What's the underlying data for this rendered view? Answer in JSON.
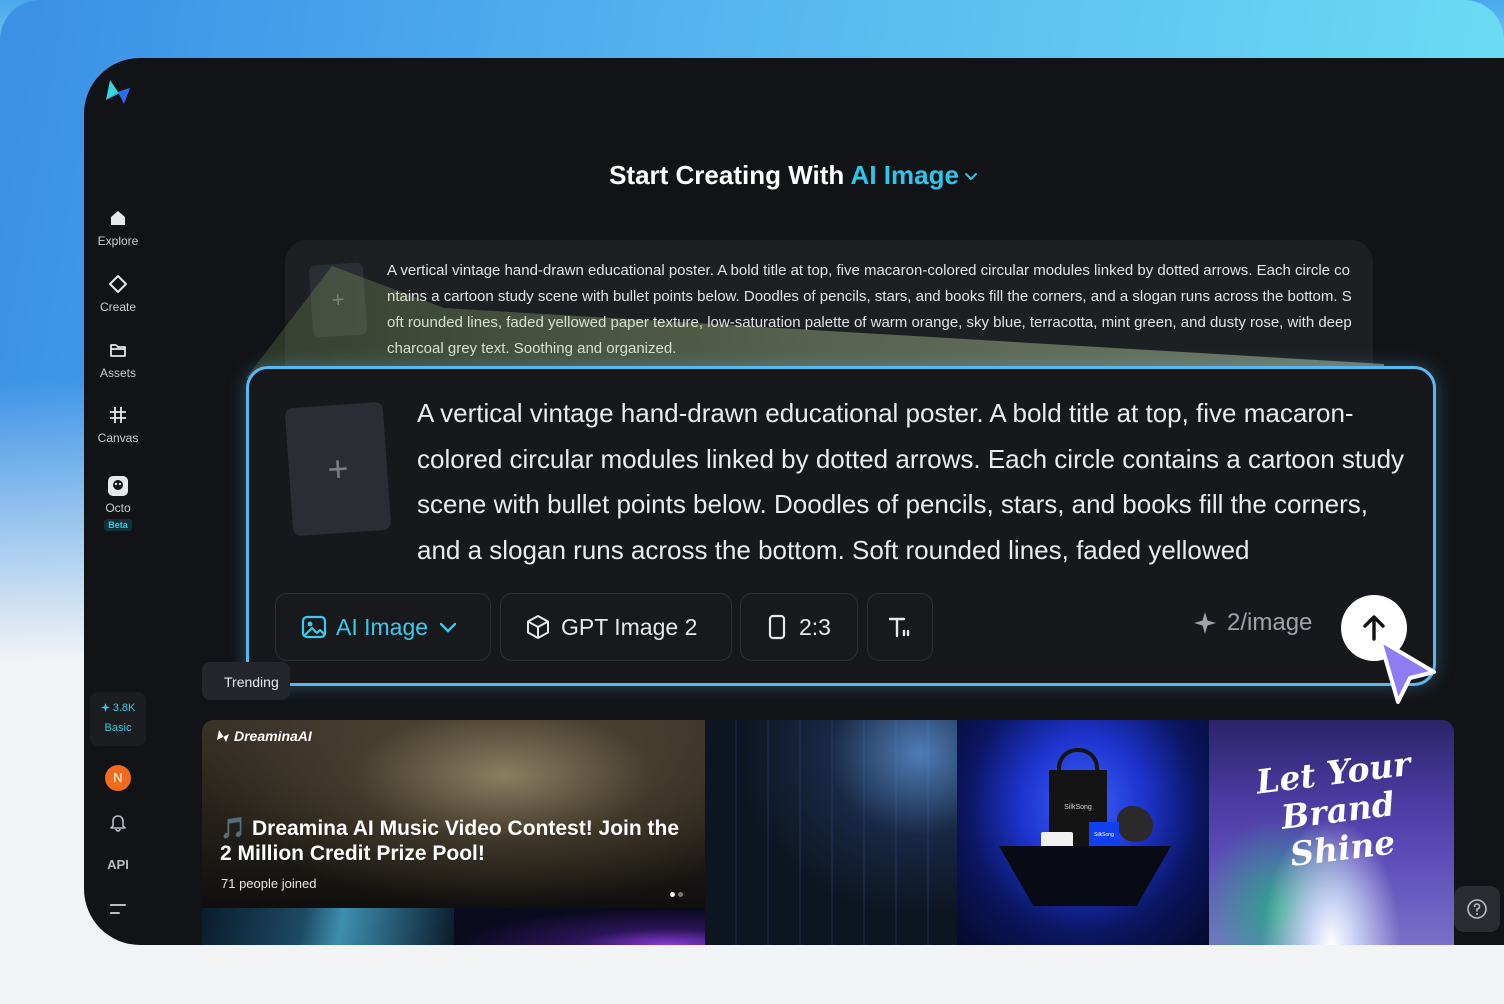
{
  "header": {
    "prefix": "Start Creating With",
    "mode": "AI Image"
  },
  "sidebar": {
    "items": [
      {
        "label": "Explore",
        "icon": "home-icon"
      },
      {
        "label": "Create",
        "icon": "sparkle-icon"
      },
      {
        "label": "Assets",
        "icon": "folder-icon"
      },
      {
        "label": "Canvas",
        "icon": "crop-icon"
      },
      {
        "label": "Octo",
        "icon": "octo-icon",
        "badge": "Beta"
      }
    ],
    "credits": {
      "count": "3.8K",
      "tier": "Basic"
    },
    "avatar_initial": "N",
    "api_label": "API"
  },
  "prompt": {
    "text": "A vertical vintage hand-drawn educational poster. A bold title at top, five macaron-colored circular modules linked by dotted arrows. Each circle contains a cartoon study scene with bullet points below. Doodles of pencils, stars, and books fill the corners, and a slogan runs across the bottom. Soft rounded lines, faded yellowed paper texture, low-saturation palette of warm orange, sky blue, terracotta, mint green, and dusty rose, with deep charcoal grey text. Soothing and organized.",
    "zoom_text": "A vertical vintage hand-drawn educational poster. A bold title at top, five macaron-colored circular modules linked by dotted arrows. Each circle contains a cartoon study scene with bullet points below. Doodles of pencils, stars, and books fill the corners, and a slogan runs across the bottom. Soft rounded lines, faded yellowed",
    "add_reference_symbol": "+"
  },
  "toolbar": {
    "mode_label": "AI Image",
    "model_label": "GPT Image 2",
    "ratio_label": "2:3",
    "cost_label": "2/image"
  },
  "tabs": {
    "trending_label": "Trending"
  },
  "gallery": {
    "brand": "DreaminaAI",
    "feature_title": "🎵 Dreamina AI Music Video Contest! Join the 2 Million Credit Prize Pool!",
    "feature_sub": "71 people joined",
    "bag_label": "SilkSong",
    "box_label": "SilkSong",
    "brand_script": "Let Your Brand Shine"
  },
  "colors": {
    "accent": "#2ec5e8",
    "app_background": "#121316",
    "zoom_border": "#58b8ef",
    "cursor": "#8f7bf2"
  }
}
